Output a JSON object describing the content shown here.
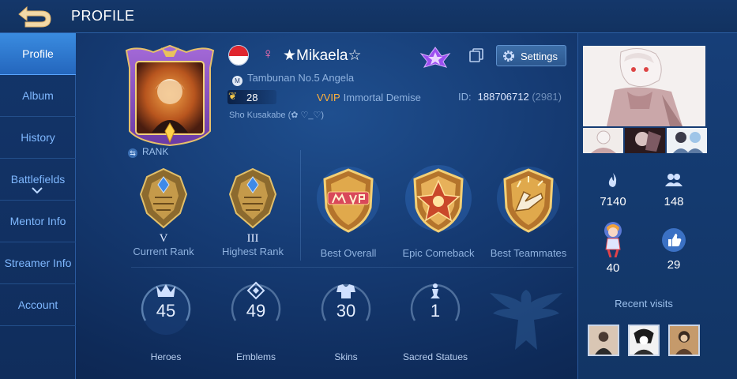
{
  "header": {
    "title": "PROFILE"
  },
  "sidebar": {
    "items": [
      {
        "label": "Profile"
      },
      {
        "label": "Album"
      },
      {
        "label": "History"
      },
      {
        "label": "Battlefields"
      },
      {
        "label": "Mentor Info"
      },
      {
        "label": "Streamer Info"
      },
      {
        "label": "Account"
      }
    ]
  },
  "profile": {
    "username": "★Mikaela☆",
    "gender_symbol": "♀",
    "guild": "Tambunan No.5 Angela",
    "guild_badge": "M",
    "level": "28",
    "vip_label": "VVIP",
    "vip_title": "Immortal Demise",
    "id_label": "ID:",
    "id_value": "188706712",
    "id_zone": "(2981)",
    "squad": "Sho Kusakabe (✿ ♡_♡)",
    "rank_tag": "RANK",
    "settings_label": "Settings",
    "flag_colors": [
      "#e0262e",
      "#ffffff"
    ]
  },
  "ranks": [
    {
      "roman": "V",
      "label": "Current Rank"
    },
    {
      "roman": "III",
      "label": "Highest Rank"
    }
  ],
  "medals": [
    {
      "label": "Best Overall"
    },
    {
      "label": "Epic Comeback"
    },
    {
      "label": "Best Teammates"
    }
  ],
  "stats": [
    {
      "value": "45",
      "label": "Heroes",
      "icon": "heroes-icon"
    },
    {
      "value": "49",
      "label": "Emblems",
      "icon": "emblem-icon"
    },
    {
      "value": "30",
      "label": "Skins",
      "icon": "skin-icon"
    },
    {
      "value": "1",
      "label": "Sacred Statues",
      "icon": "statue-icon"
    }
  ],
  "social": {
    "popularity": "7140",
    "friends": "148",
    "mentor": "40",
    "likes": "29",
    "recent_visits_label": "Recent visits"
  }
}
